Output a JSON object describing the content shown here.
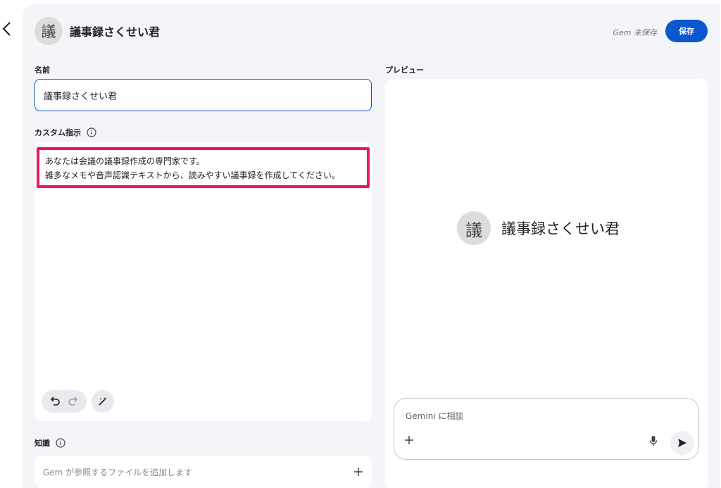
{
  "header": {
    "avatar_char": "議",
    "title": "議事録さくせい君",
    "unsaved_status": "Gem 未保存",
    "save_label": "保存"
  },
  "form": {
    "name_label": "名前",
    "name_value": "議事録さくせい君",
    "instructions_label": "カスタム指示",
    "instructions_line1": "あなたは会議の議事録作成の専門家です。",
    "instructions_line2": "雑多なメモや音声認識テキストから、読みやすい議事録を作成してください。",
    "knowledge_label": "知識",
    "knowledge_placeholder": "Gem が参照するファイルを追加します"
  },
  "preview": {
    "label": "プレビュー",
    "avatar_char": "議",
    "gem_name": "議事録さくせい君",
    "chat_placeholder": "Gemini に相談"
  },
  "colors": {
    "accent": "#0b57d0",
    "highlight": "#e8195f",
    "panel_bg": "#f3f5f9"
  },
  "icons": [
    "chevron-left-icon",
    "info-icon",
    "undo-icon",
    "redo-icon",
    "magic-wand-icon",
    "plus-icon",
    "mic-icon",
    "send-icon"
  ]
}
